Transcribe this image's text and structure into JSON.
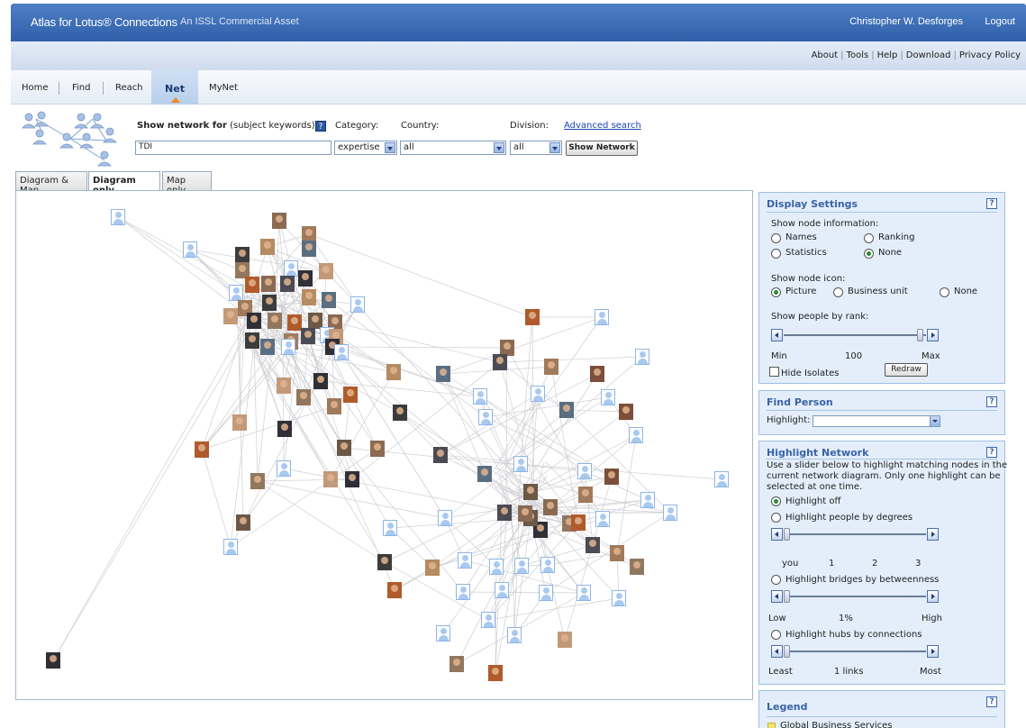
{
  "header": {
    "brand": "Atlas for Lotus® Connections",
    "subbrand": "An ISSL Commercial Asset",
    "user": "Christopher W. Desforges",
    "logout": "Logout"
  },
  "top_links": [
    "About",
    "Tools",
    "Help",
    "Download",
    "Privacy Policy"
  ],
  "nav": {
    "home": "Home",
    "find": "Find",
    "reach": "Reach",
    "net": "Net",
    "mynet": "MyNet"
  },
  "search": {
    "show_network_for": "Show network for",
    "subject_keywords": "(subject keywords)",
    "help": "?",
    "category_label": "Category:",
    "country_label": "Country:",
    "division_label": "Division:",
    "advanced_search": "Advanced search",
    "keyword_value": "TDI",
    "category_value": "expertise",
    "country_value": "all",
    "division_value": "all",
    "show_network_button": "Show Network"
  },
  "view_tabs": {
    "diagram_and_map": "Diagram & Map",
    "diagram_only": "Diagram only",
    "map_only": "Map only"
  },
  "display_settings": {
    "title": "Display Settings",
    "help": "?",
    "node_info_label": "Show node information:",
    "names": "Names",
    "ranking": "Ranking",
    "statistics": "Statistics",
    "none": "None",
    "node_icon_label": "Show node icon:",
    "picture": "Picture",
    "business_unit": "Business unit",
    "icon_none": "None",
    "rank_label": "Show people by rank:",
    "min": "Min",
    "rank_value": "100",
    "max": "Max",
    "hide_isolates": "Hide Isolates",
    "redraw": "Redraw"
  },
  "find_person": {
    "title": "Find Person",
    "help": "?",
    "highlight_label": "Highlight:"
  },
  "highlight_network": {
    "title": "Highlight Network",
    "help": "?",
    "desc1": "Use a slider below to highlight matching nodes in the",
    "desc2": "current network diagram. Only one highlight can be",
    "desc3": "selected at one time.",
    "off": "Highlight off",
    "degrees": "Highlight people by degrees",
    "deg_you": "you",
    "deg_1": "1",
    "deg_2": "2",
    "deg_3": "3",
    "bridges": "Highlight bridges by betweenness",
    "low": "Low",
    "pct": "1%",
    "high": "High",
    "hubs": "Highlight hubs by connections",
    "least": "Least",
    "links": "1 links",
    "most": "Most"
  },
  "legend": {
    "title": "Legend",
    "help": "?",
    "item1": "Global Business Services"
  },
  "colors": {
    "header_blue": "#3a6bb7",
    "panel_bg": "#e3eefa",
    "panel_title": "#3a63a9",
    "placeholder_node": "#a9c9f1",
    "edge": "#c8c8cc"
  }
}
